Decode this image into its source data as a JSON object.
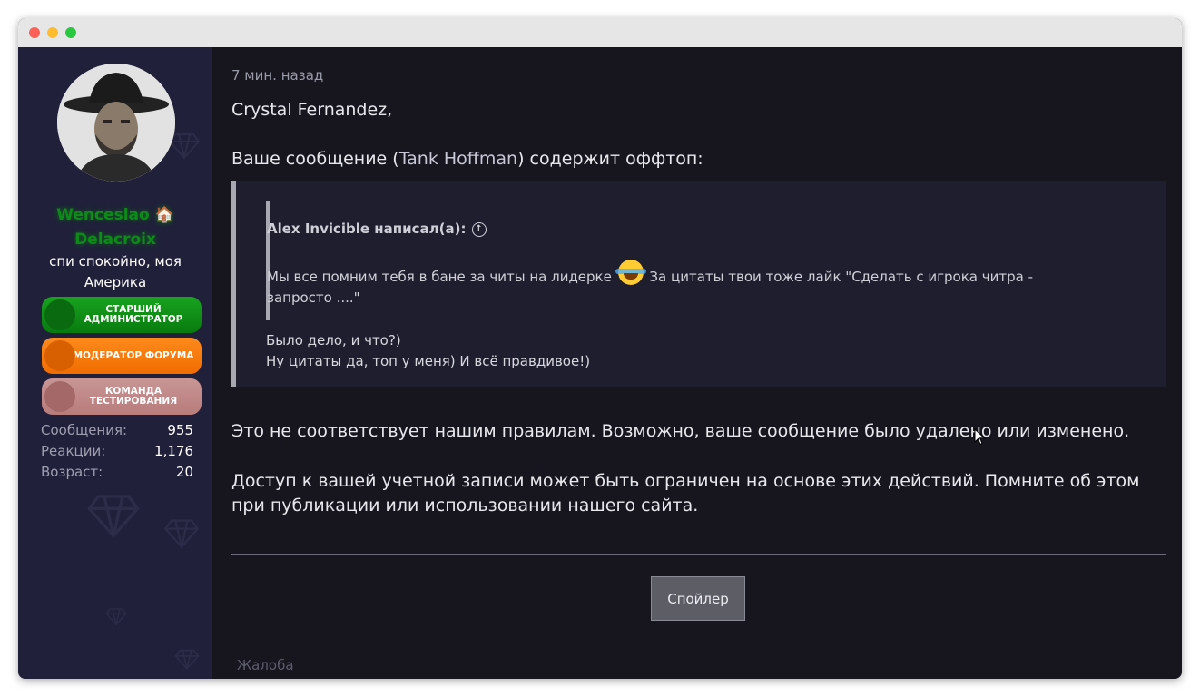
{
  "sidebar": {
    "username": "Wenceslao 🏠 Delacroix",
    "user_title": "спи спокойно, моя Америка",
    "banners": [
      {
        "label": "СТАРШИЙ АДМИНИСТРАТОР",
        "color": "#0f9117"
      },
      {
        "label": "МОДЕРАТОР ФОРУМА",
        "color": "#f57a0a"
      },
      {
        "label": "КОМАНДА ТЕСТИРОВАНИЯ",
        "color": "#c08888"
      }
    ],
    "stats": [
      {
        "label": "Сообщения:",
        "value": "955"
      },
      {
        "label": "Реакции:",
        "value": "1,176"
      },
      {
        "label": "Возраст:",
        "value": "20"
      }
    ]
  },
  "post": {
    "time": "7 мин. назад",
    "greeting": "Crystal Fernandez,",
    "intro_before": "Ваше сообщение (",
    "intro_author": "Tank Hoffman",
    "intro_after": ") содержит оффтоп:",
    "quote": {
      "author": "Alex Invicible написал(а):",
      "text_before": "Мы все помним тебя в бане за читы на лидерке",
      "text_after": "За цитаты твои тоже лайк \"Сделать с игрока читра - запросто ....\""
    },
    "reply_line1": "Было дело, и что?)",
    "reply_line2": "Ну цитаты да, топ у меня) И всё правдивое!)",
    "rule_text": "Это не соответствует нашим правилам. Возможно, ваше сообщение было удалено или изменено.",
    "access_text": "Доступ к вашей учетной записи может быть ограничен на основе этих действий. Помните об этом при публикации или использовании нашего сайта.",
    "spoiler_label": "Спойлер",
    "report_label": "Жалоба"
  }
}
